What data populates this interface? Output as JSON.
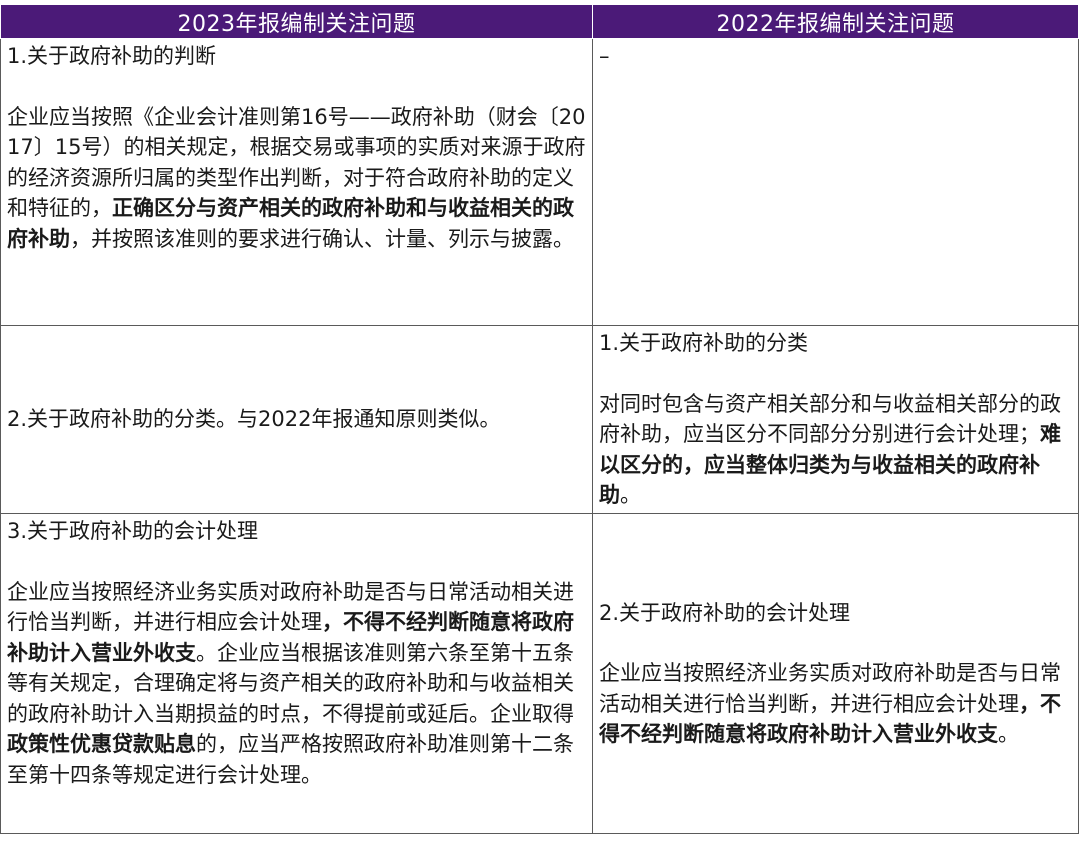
{
  "table": {
    "headers": [
      "2023年报编制关注问题",
      "2022年报编制关注问题"
    ],
    "rows": [
      {
        "left": {
          "title": "1.关于政府补助的判断",
          "body_before": "企业应当按照《企业会计准则第16号——政府补助（财会〔2017〕15号）的相关规定，根据交易或事项的实质对来源于政府的经济资源所归属的类型作出判断，对于符合政府补助的定义和特征的，",
          "body_bold": "正确区分与资产相关的政府补助和与收益相关的政府补助",
          "body_after": "，并按照该准则的要求进行确认、计量、列示与披露。"
        },
        "right": {
          "text": "–"
        }
      },
      {
        "left": {
          "text": "2.关于政府补助的分类。与2022年报通知原则类似。"
        },
        "right": {
          "title": "1.关于政府补助的分类",
          "body_before": "对同时包含与资产相关部分和与收益相关部分的政府补助，应当区分不同部分分别进行会计处理；",
          "body_bold": "难以区分的，应当整体归类为与收益相关的政府补助",
          "body_after": "。"
        }
      },
      {
        "left": {
          "title": "3.关于政府补助的会计处理",
          "body_1": "企业应当按照经济业务实质对政府补助是否与日常活动相关进行恰当判断，并进行相应会计处理",
          "bold_1": "，不得不经判断随意将政府补助计入营业外收支",
          "body_2": "。企业应当根据该准则第六条至第十五条等有关规定，合理确定将与资产相关的政府补助和与收益相关的政府补助计入当期损益的时点，不得提前或延后。企业取得",
          "bold_2": "政策性优惠贷款贴息",
          "body_3": "的，应当严格按照政府补助准则第十二条至第十四条等规定进行会计处理。"
        },
        "right": {
          "title": "2.关于政府补助的会计处理",
          "body_before": "企业应当按照经济业务实质对政府补助是否与日常活动相关进行恰当判断，并进行相应会计处理",
          "body_bold": "，不得不经判断随意将政府补助计入营业外收支",
          "body_after": "。"
        }
      }
    ]
  }
}
